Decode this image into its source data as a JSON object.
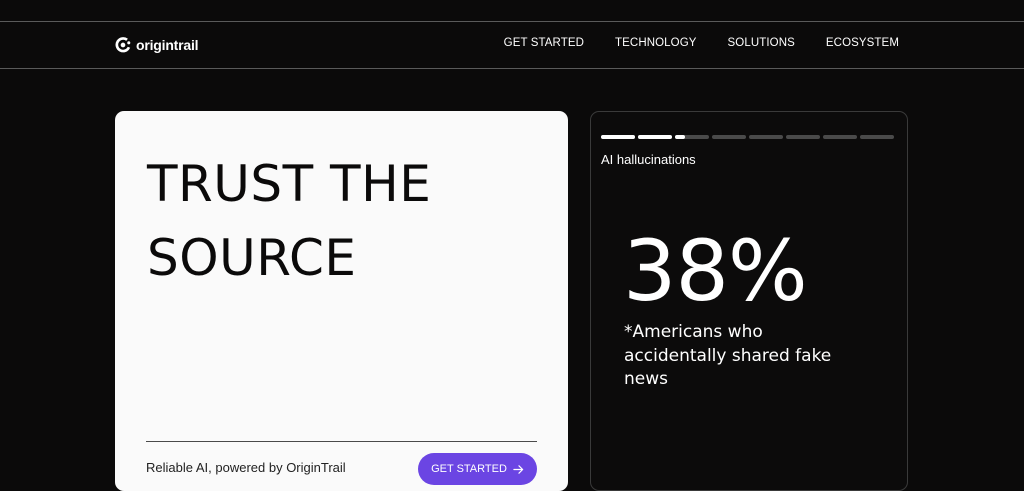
{
  "brand": {
    "name": "origintrail",
    "icon": "origintrail-logo-icon"
  },
  "nav": {
    "links": [
      "GET STARTED",
      "TECHNOLOGY",
      "SOLUTIONS",
      "ECOSYSTEM"
    ]
  },
  "hero": {
    "title_line1": "TRUST THE",
    "title_line2": "SOURCE",
    "tagline": "Reliable AI, powered by OriginTrail",
    "cta_label": "GET STARTED",
    "cta_icon": "arrow-right-icon"
  },
  "stat": {
    "label": "AI hallucinations",
    "value": "38%",
    "caption": "*Americans who accidentally shared fake news",
    "progress": [
      1,
      1,
      0.3,
      0,
      0,
      0,
      0,
      0
    ]
  },
  "colors": {
    "background": "#0b0a0a",
    "hero_card": "#fafafa",
    "accent": "#6b45e3",
    "segment_empty": "#4a4a4a"
  }
}
